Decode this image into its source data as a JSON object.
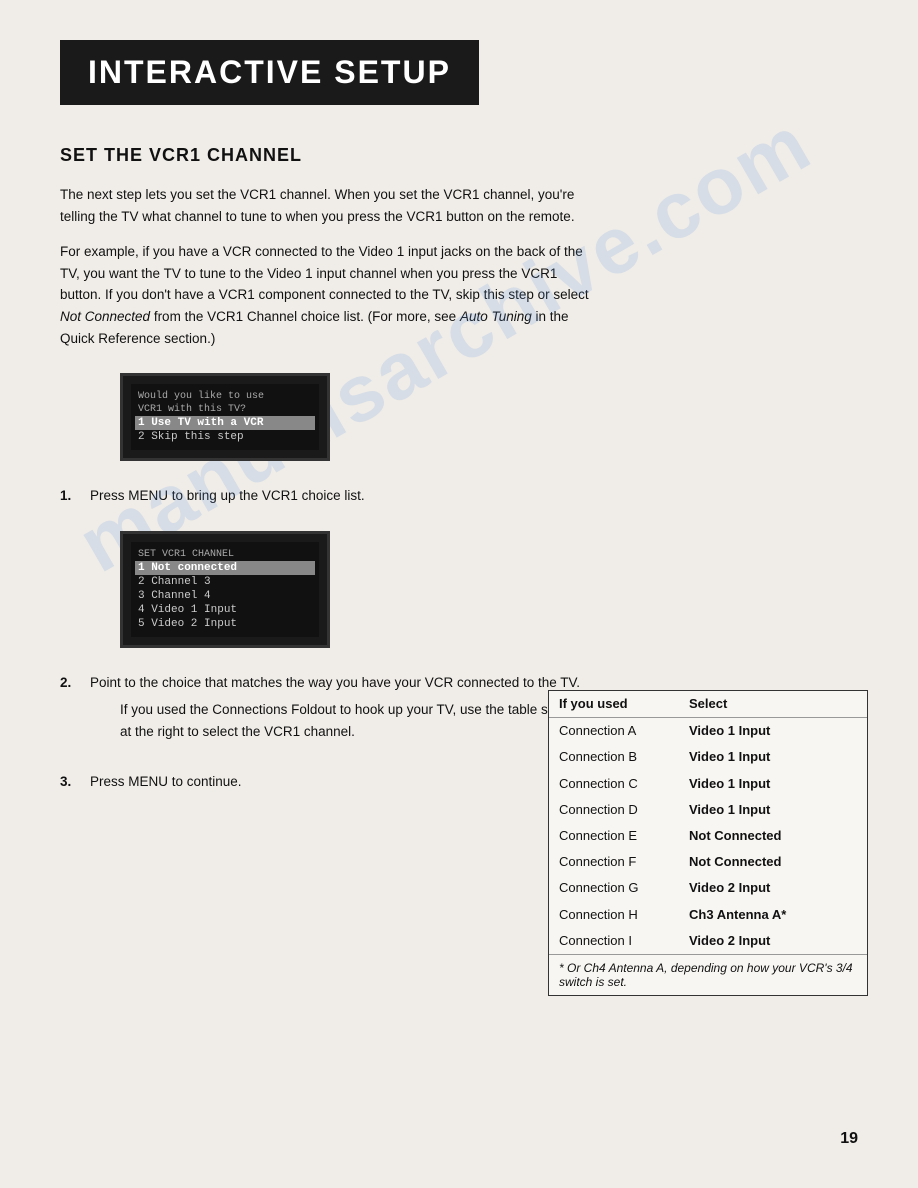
{
  "header": {
    "title": "INTERACTIVE SETUP"
  },
  "section": {
    "title": "SET THE VCR1 CHANNEL"
  },
  "paragraphs": [
    "The next step lets you set the VCR1 channel. When you set the VCR1 channel, you're telling the TV what channel to tune to when you press the VCR1 button on the remote.",
    "For example, if you have a VCR connected to the Video 1 input jacks on the back of the TV, you want the TV to tune to the Video 1 input channel when you press the VCR1 button. If you don't have a VCR1 component connected to the TV, skip this step or select Not Connected from the VCR1 Channel choice list. (For more, see Auto Tuning in the Quick Reference section.)"
  ],
  "screen1": {
    "rows": [
      {
        "text": "Would you like to use",
        "type": "header"
      },
      {
        "text": "VCR1 with this TV?",
        "type": "header"
      },
      {
        "text": "1 Use TV with a VCR",
        "type": "selected"
      },
      {
        "text": "2 Skip this step",
        "type": "normal"
      }
    ]
  },
  "screen2": {
    "rows": [
      {
        "text": "SET VCR1 CHANNEL",
        "type": "header"
      },
      {
        "text": "1 Not connected",
        "type": "selected"
      },
      {
        "text": "2 Channel 3",
        "type": "normal"
      },
      {
        "text": "3 Channel 4",
        "type": "normal"
      },
      {
        "text": "4 Video 1 Input",
        "type": "normal"
      },
      {
        "text": "5 Video 2 Input",
        "type": "normal"
      }
    ]
  },
  "steps": [
    {
      "num": "1.",
      "text": "Press MENU to bring up the VCR1 choice list."
    },
    {
      "num": "2.",
      "text": "Point to the choice that matches the way you have your VCR connected to the TV.",
      "subtext": "If you used the Connections Foldout to hook up your TV, use the table shown at the right to select the VCR1 channel."
    },
    {
      "num": "3.",
      "text": "Press MENU to continue."
    }
  ],
  "table": {
    "header": [
      "If you used",
      "Select"
    ],
    "rows": [
      [
        "Connection A",
        "Video 1 Input"
      ],
      [
        "Connection B",
        "Video 1 Input"
      ],
      [
        "Connection C",
        "Video 1 Input"
      ],
      [
        "Connection D",
        "Video 1 Input"
      ],
      [
        "Connection E",
        "Not Connected"
      ],
      [
        "Connection F",
        "Not Connected"
      ],
      [
        "Connection G",
        "Video 2 Input"
      ],
      [
        "Connection H",
        "Ch3 Antenna A*"
      ],
      [
        "Connection I",
        "Video 2 Input"
      ]
    ],
    "footer": "* Or Ch4 Antenna A, depending on how your VCR's 3/4 switch is set."
  },
  "watermark": {
    "lines": [
      "manualsarchive.com"
    ]
  },
  "page_number": "19"
}
